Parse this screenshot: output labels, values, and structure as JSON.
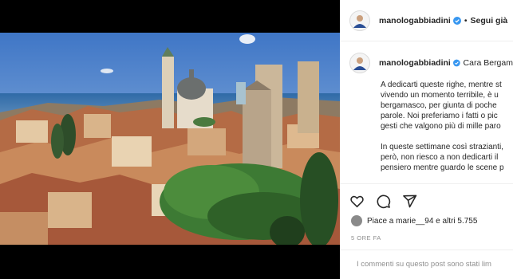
{
  "post": {
    "username": "manologabbiadini",
    "follow_label": "Segui già",
    "caption_title": "Cara Bergam",
    "caption_lines_1": [
      "A dedicarti queste righe, mentre st",
      "vivendo un momento terribile, è u",
      "bergamasco, per giunta di poche",
      "parole. Noi preferiamo i fatti o pic",
      "gesti che valgono più di mille paro"
    ],
    "caption_lines_2": [
      "In queste settimane così strazianti,",
      "però, non riesco a non dedicarti il",
      "pensiero mentre guardo le scene p"
    ],
    "likes_text": "Piace a marie__94 e altri 5.755",
    "time_label": "5 ORE FA",
    "comments_disabled": "I commenti su questo post sono stati lim"
  },
  "icons": [
    "verified-icon",
    "heart-icon",
    "comment-icon",
    "share-icon"
  ],
  "colors": {
    "verified": "#3897f0",
    "text": "#262626",
    "muted": "#8e8e8e"
  }
}
